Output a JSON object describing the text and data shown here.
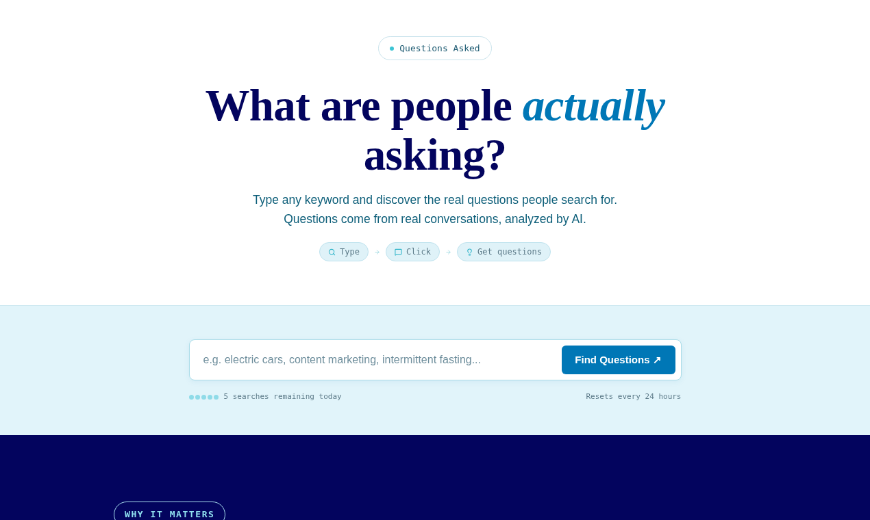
{
  "badge": {
    "label": "Questions Asked"
  },
  "hero": {
    "heading": "What are people *actually* asking?",
    "subtitle_lines": [
      "Type any keyword and discover the real questions people search for.",
      "Questions come from real conversations, analyzed by AI."
    ],
    "steps": [
      {
        "kind": "search",
        "label": "Type"
      },
      {
        "kind": "chat",
        "label": "Click"
      },
      {
        "kind": "idea",
        "label": "Get questions"
      }
    ]
  },
  "search": {
    "placeholder": "e.g. electric cars, content marketing, intermittent fasting...",
    "button": "Find Questions ↗",
    "quota_dots": [
      {
        "filled": true
      },
      {
        "filled": true
      },
      {
        "filled": true
      },
      {
        "filled": true
      },
      {
        "filled": true
      }
    ],
    "remaining": "5 searches remaining today",
    "reset_note": "Resets every 24 hours"
  },
  "why_section": {
    "badge": "WHY IT MATTERS"
  }
}
